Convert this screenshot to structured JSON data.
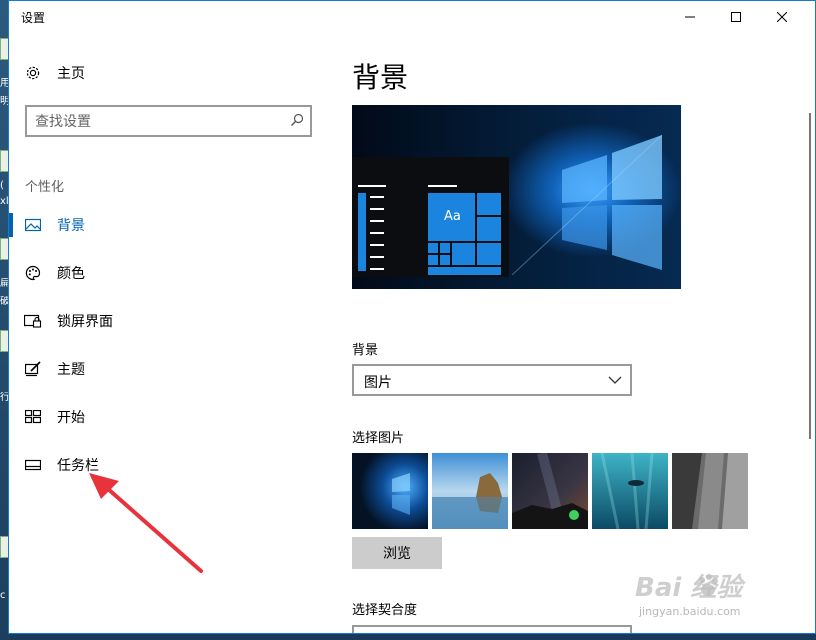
{
  "window": {
    "title": "设置"
  },
  "sidebar": {
    "home_label": "主页",
    "search_placeholder": "查找设置",
    "section": "个性化",
    "items": [
      {
        "label": "背景",
        "icon": "picture-icon",
        "active": true
      },
      {
        "label": "颜色",
        "icon": "palette-icon",
        "active": false
      },
      {
        "label": "锁屏界面",
        "icon": "lock-screen-icon",
        "active": false
      },
      {
        "label": "主题",
        "icon": "theme-brush-icon",
        "active": false
      },
      {
        "label": "开始",
        "icon": "start-tiles-icon",
        "active": false
      },
      {
        "label": "任务栏",
        "icon": "taskbar-icon",
        "active": false
      }
    ]
  },
  "main": {
    "title": "背景",
    "preview": {
      "tile_text": "Aa"
    },
    "background_label": "背景",
    "background_value": "图片",
    "choose_picture_label": "选择图片",
    "browse_label": "浏览",
    "fit_label": "选择契合度"
  },
  "watermark": {
    "brand": "Bai 经验",
    "url": "jingyan.baidu.com"
  },
  "desktop": {
    "fragments": [
      "用",
      "明",
      "(",
      "xl",
      "扁",
      "破",
      "行",
      "c"
    ]
  },
  "colors": {
    "accent": "#0063b1",
    "annotation_arrow": "#e8323c"
  }
}
